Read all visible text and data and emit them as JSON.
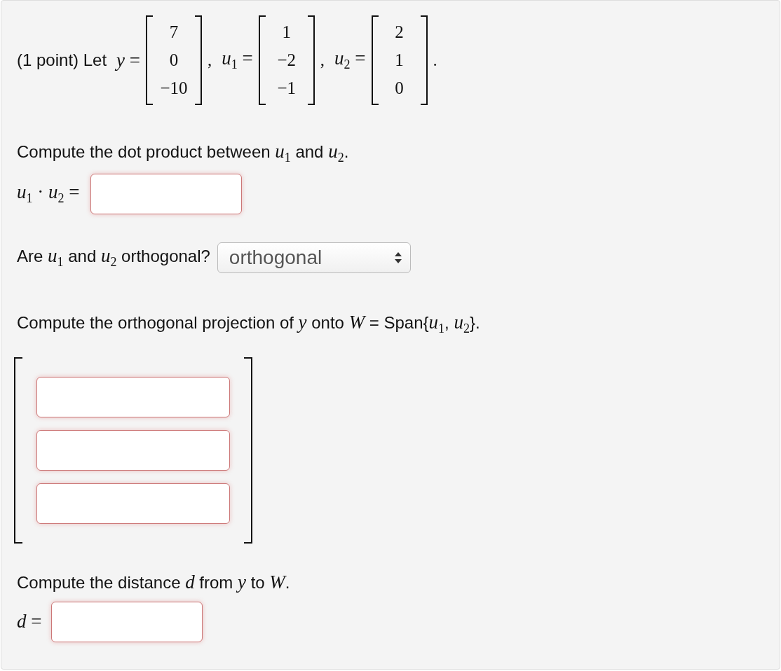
{
  "problem": {
    "intro": "(1 point) Let",
    "vectors": [
      {
        "label": "*y* =",
        "entries": [
          "7",
          "0",
          "−10"
        ],
        "separator": ","
      },
      {
        "label": "*u*$_{1}$ =",
        "entries": [
          "1",
          "−2",
          "−1"
        ],
        "separator": ","
      },
      {
        "label": "*u*$_{2}$ =",
        "entries": [
          "2",
          "1",
          "0"
        ],
        "separator": "."
      }
    ]
  },
  "dot_product": {
    "prompt": "Compute the dot product between *u*$_{1}$ and *u*$_{2}$.",
    "label": "*u*$_{1}$ · *u*$_{2}$ ="
  },
  "orthogonality": {
    "prompt": "Are *u*$_{1}$ and *u*$_{2}$ orthogonal?",
    "select": {
      "value": "orthogonal"
    }
  },
  "projection": {
    "prompt": "Compute the orthogonal projection of *y* onto *W* = Span{*u*$_{1}$, *u*$_{2}$}.",
    "fields": [
      {
        "kind": "input"
      },
      {
        "kind": "input"
      },
      {
        "kind": "input"
      }
    ]
  },
  "distance": {
    "prompt": "Compute the distance *d* from *y* to *W*.",
    "label": "*d* ="
  }
}
